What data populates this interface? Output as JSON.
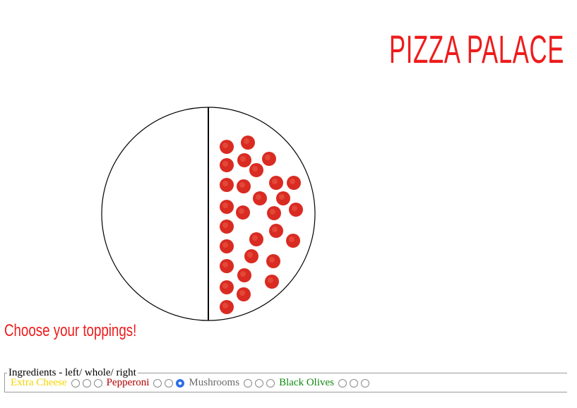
{
  "header": {
    "brand": "PIZZA PALACE",
    "brand_color": "#ee1c1c"
  },
  "pizza": {
    "outline_color": "#000000",
    "pepperoni_color": "#d92b22",
    "left_half_toppings": [],
    "right_half_toppings": [
      "Pepperoni"
    ]
  },
  "toppings_heading": "Choose your toppings!",
  "ingredients": {
    "legend": "Ingredients - left/ whole/ right",
    "items": [
      {
        "name": "Extra Cheese",
        "color": "#f5d400",
        "selected": null
      },
      {
        "name": "Pepperoni",
        "color": "#b20000",
        "selected": null
      },
      {
        "name": "Mushrooms",
        "color": "#6b6b6b",
        "selected": "left"
      },
      {
        "name": "Black Olives",
        "color": "#0f8a0f",
        "selected": null
      }
    ],
    "options": [
      "left",
      "whole",
      "right"
    ]
  }
}
